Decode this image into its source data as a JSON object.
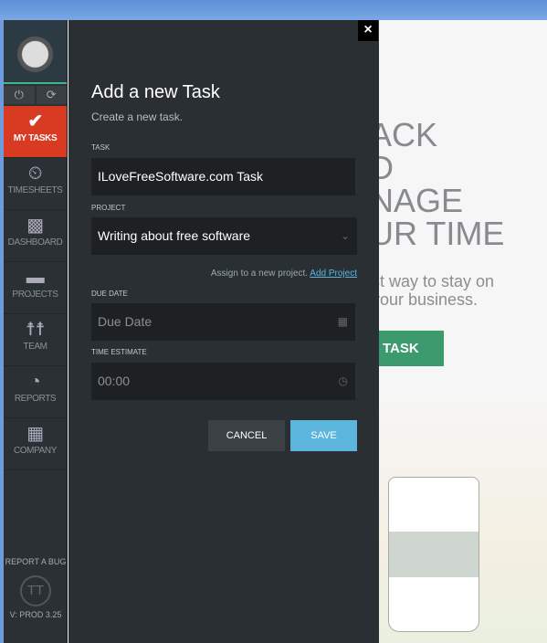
{
  "sidebar": {
    "items": [
      {
        "label": "MY TASKS",
        "icon": "check-icon",
        "active": true
      },
      {
        "label": "TIMESHEETS",
        "icon": "stopwatch-icon"
      },
      {
        "label": "DASHBOARD",
        "icon": "chart-icon"
      },
      {
        "label": "PROJECTS",
        "icon": "folder-icon"
      },
      {
        "label": "TEAM",
        "icon": "people-icon"
      },
      {
        "label": "REPORTS",
        "icon": "report-icon"
      },
      {
        "label": "COMPANY",
        "icon": "building-icon"
      }
    ],
    "report_bug": "REPORT A BUG",
    "logo_text": "TT",
    "version": "V: PROD 3.25"
  },
  "modal": {
    "title": "Add a new Task",
    "subtitle": "Create a new task.",
    "task_label": "TASK",
    "task_value": "ILoveFreeSoftware.com Task",
    "project_label": "PROJECT",
    "project_value": "Writing about free software",
    "assign_text": "Assign to a new project.",
    "add_project": "Add Project",
    "due_label": "DUE DATE",
    "due_placeholder": "Due Date",
    "time_label": "TIME ESTIMATE",
    "time_value": "00:00",
    "cancel": "CANCEL",
    "save": "SAVE",
    "close": "×"
  },
  "background": {
    "hero": "ACK\nD\nNAGE\nUR TIME",
    "tagline": "st way to stay on\nyour business.",
    "cta": "TASK"
  },
  "colors": {
    "accent_red": "#d93a22",
    "save_blue": "#5bb5dc",
    "cta_green": "#3d9a6e"
  }
}
